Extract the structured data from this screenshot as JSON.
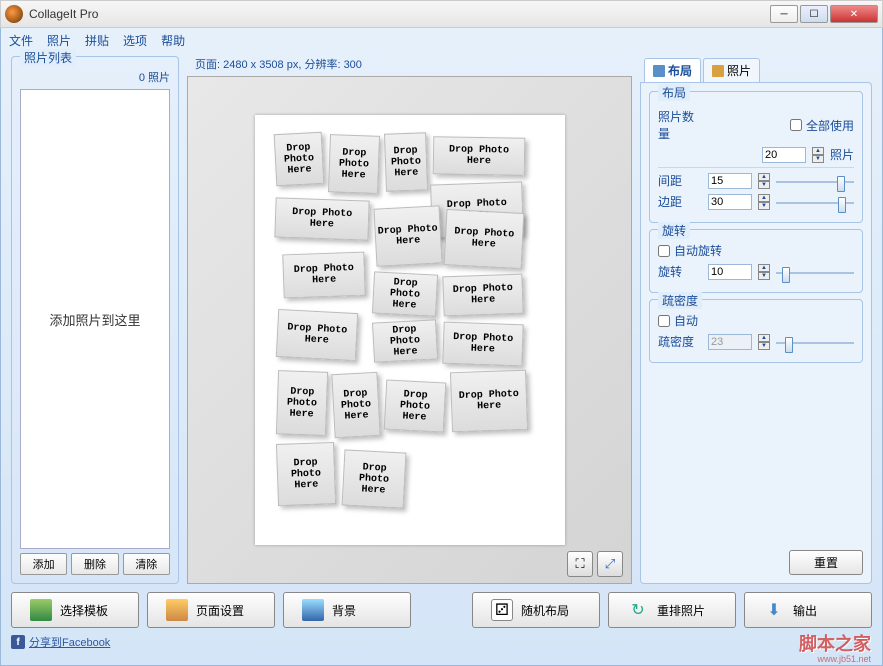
{
  "window": {
    "title": "CollageIt Pro"
  },
  "menu": [
    "文件",
    "照片",
    "拼贴",
    "选项",
    "帮助"
  ],
  "left": {
    "group_label": "照片列表",
    "count": "0 照片",
    "placeholder": "添加照片到这里",
    "btn_add": "添加",
    "btn_delete": "删除",
    "btn_clear": "清除"
  },
  "center": {
    "page_info": "页面: 2480 x 3508 px, 分辨率: 300",
    "drop_text": "Drop Photo Here"
  },
  "right": {
    "tab_layout": "布局",
    "tab_photo": "照片",
    "g_layout": "布局",
    "photo_count_label": "照片数量",
    "use_all": "全部使用",
    "photo_count_value": "20",
    "photo_suffix": "照片",
    "spacing_label": "间距",
    "spacing_value": "15",
    "margin_label": "边距",
    "margin_value": "30",
    "g_rotate": "旋转",
    "auto_rotate": "自动旋转",
    "rotate_label": "旋转",
    "rotate_value": "10",
    "g_density": "疏密度",
    "auto_density": "自动",
    "density_label": "疏密度",
    "density_value": "23",
    "reset": "重置"
  },
  "bottom": {
    "template": "选择模板",
    "page_setup": "页面设置",
    "background": "背景",
    "random": "随机布局",
    "reorder": "重排照片",
    "export": "输出",
    "facebook": "分享到Facebook"
  },
  "watermark": "脚本之家",
  "watermark_url": "www.jb51.net"
}
